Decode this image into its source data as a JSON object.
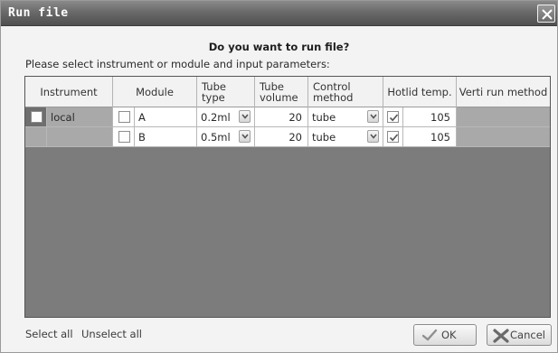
{
  "window": {
    "title": "Run file"
  },
  "dialog": {
    "question": "Do you want to run file?",
    "hint": "Please select instrument or module and input parameters:"
  },
  "table": {
    "headers": {
      "instrument": "Instrument",
      "module": "Module",
      "tube_type_1": "Tube",
      "tube_type_2": "type",
      "tube_volume_1": "Tube",
      "tube_volume_2": "volume",
      "control_method_1": "Control",
      "control_method_2": "method",
      "hotlid_temp": "Hotlid temp.",
      "verti_run_method": "Verti run method"
    },
    "rows": [
      {
        "instrument": "local",
        "instrument_checked": false,
        "module_checked": false,
        "module": "A",
        "tube_type": "0.2ml",
        "tube_volume": "20",
        "control_method": "tube",
        "hotlid_checked": true,
        "hotlid_temp": "105"
      },
      {
        "instrument": "",
        "module_checked": false,
        "module": "B",
        "tube_type": "0.5ml",
        "tube_volume": "20",
        "control_method": "tube",
        "hotlid_checked": true,
        "hotlid_temp": "105"
      }
    ]
  },
  "footer": {
    "select_all": "Select all",
    "unselect_all": "Unselect all",
    "ok_label": "OK",
    "cancel_label": "Cancel"
  },
  "icons": {
    "close": "close-icon",
    "ok": "check-icon",
    "cancel": "x-icon"
  }
}
